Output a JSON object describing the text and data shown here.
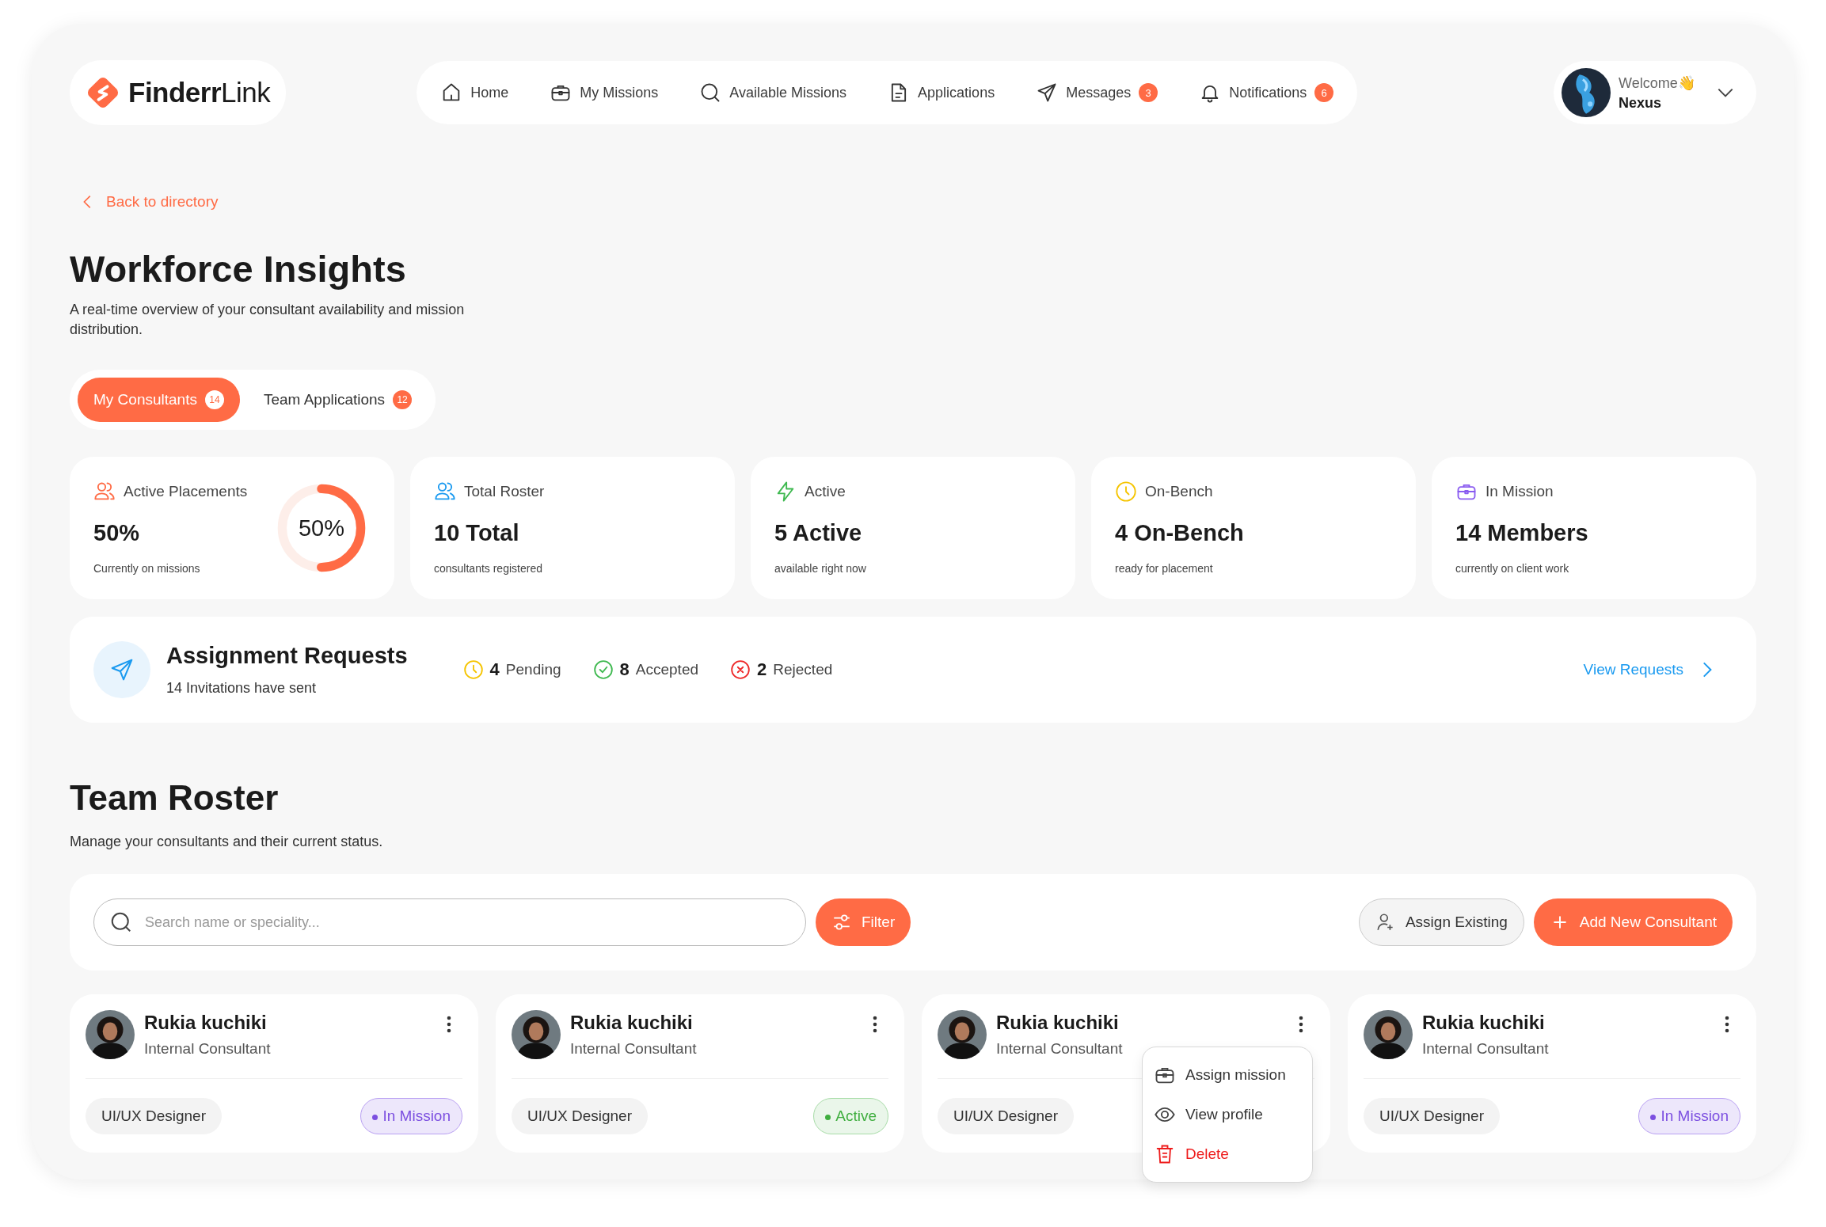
{
  "brand": {
    "part_1": "Finderr",
    "part_2": "Link"
  },
  "nav": [
    {
      "label": "Home",
      "selected": false
    },
    {
      "label": "My Missions",
      "selected": false
    },
    {
      "label": "Available Missions",
      "selected": false
    },
    {
      "label": "Applications",
      "selected": false
    },
    {
      "label": "Messages",
      "badge": "3",
      "selected": false
    },
    {
      "label": "Notifications",
      "badge": "6",
      "selected": false
    }
  ],
  "user": {
    "greeting": "Welcome",
    "wave": "👋",
    "name": "Nexus"
  },
  "back_link": "Back to directory",
  "page": {
    "title": "Workforce Insights",
    "description": "A real-time overview of your consultant availability and mission distribution."
  },
  "tabs": [
    {
      "label": "My Consultants",
      "count": "14",
      "selected": true
    },
    {
      "label": "Team Applications",
      "count": "12",
      "selected": false
    }
  ],
  "stats": [
    {
      "kind": "placements",
      "label": "Active Placements",
      "value": "50%",
      "note": "Currently on missions",
      "level": 0.5,
      "reading": "50%"
    },
    {
      "kind": "roster",
      "label": "Total Roster",
      "value": "10 Total",
      "note": "consultants registered"
    },
    {
      "kind": "active",
      "label": "Active",
      "value": "5 Active",
      "note": "available right now"
    },
    {
      "kind": "bench",
      "label": "On-Bench",
      "value": "4 On-Bench",
      "note": "ready for placement"
    },
    {
      "kind": "mission",
      "label": "In Mission",
      "value": "14 Members",
      "note": "currently on client work"
    }
  ],
  "requests": {
    "title": "Assignment Requests",
    "subtitle": "14 Invitations have sent",
    "link": "View Requests",
    "counts": [
      {
        "kind": "pending",
        "number": "4",
        "label": "Pending"
      },
      {
        "kind": "accepted",
        "number": "8",
        "label": "Accepted"
      },
      {
        "kind": "rejected",
        "number": "2",
        "label": "Rejected"
      }
    ]
  },
  "roster": {
    "title": "Team Roster",
    "description": "Manage your consultants and their current status.",
    "search": {
      "placeholder": "Search name or speciality..."
    },
    "filter": "Filter",
    "assign": "Assign Existing",
    "add": "Add New Consultant"
  },
  "cards": [
    {
      "name": "Rukia kuchiki",
      "role": "Internal Consultant",
      "specialty": "UI/UX Designer",
      "status": {
        "kind": "mission",
        "label": "In Mission"
      }
    },
    {
      "name": "Rukia kuchiki",
      "role": "Internal Consultant",
      "specialty": "UI/UX Designer",
      "status": {
        "kind": "active",
        "label": "Active"
      }
    },
    {
      "name": "Rukia kuchiki",
      "role": "Internal Consultant",
      "specialty": "UI/UX Designer",
      "menu": [
        {
          "kind": "assign",
          "label": "Assign mission"
        },
        {
          "kind": "view",
          "label": "View profile"
        },
        {
          "kind": "delete",
          "label": "Delete"
        }
      ]
    },
    {
      "name": "Rukia kuchiki",
      "role": "Internal Consultant",
      "specialty": "UI/UX Designer",
      "status": {
        "kind": "mission",
        "label": "In Mission"
      }
    }
  ]
}
